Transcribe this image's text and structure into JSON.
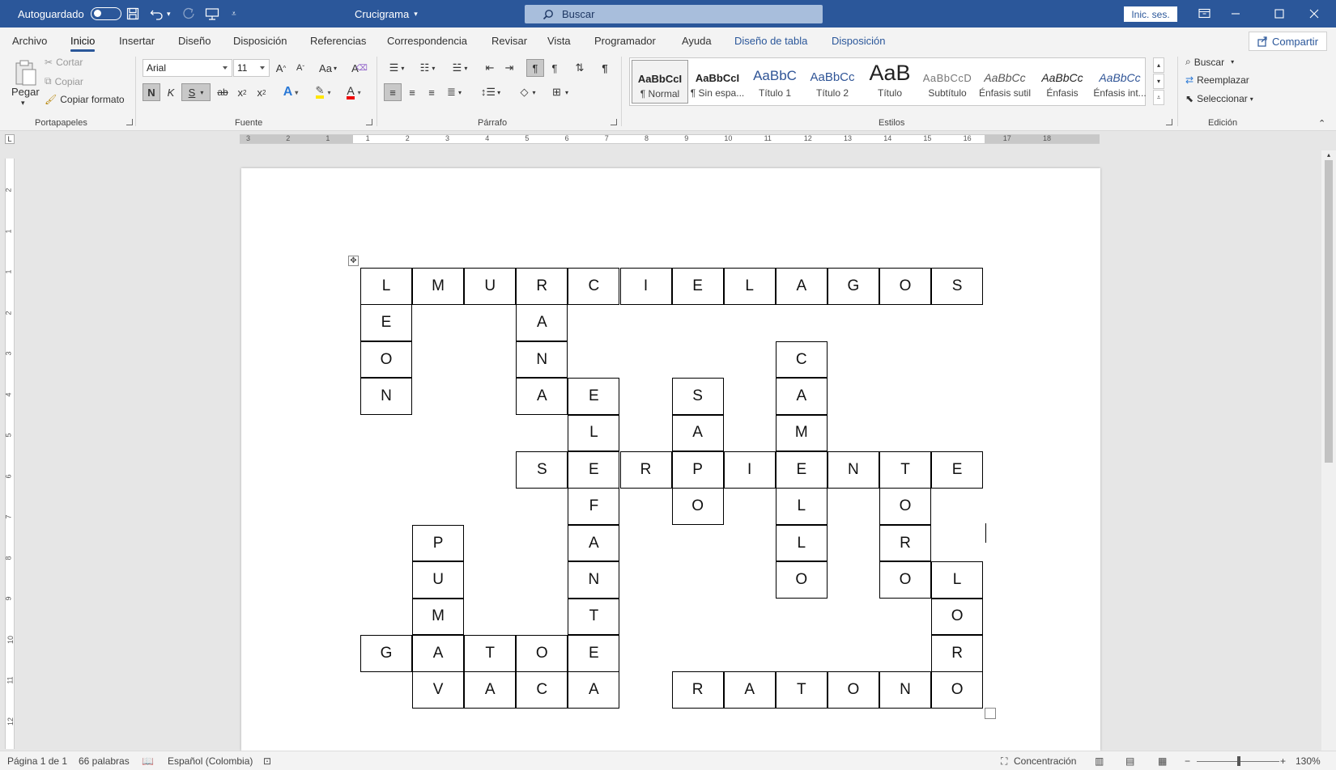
{
  "titlebar": {
    "autosave_label": "Autoguardado",
    "doc_title": "Crucigrama",
    "search_placeholder": "Buscar",
    "signin_label": "Inic. ses."
  },
  "menu": {
    "tabs": [
      "Archivo",
      "Inicio",
      "Insertar",
      "Diseño",
      "Disposición",
      "Referencias",
      "Correspondencia",
      "Revisar",
      "Vista",
      "Programador",
      "Ayuda"
    ],
    "contextual_tabs": [
      "Diseño de tabla",
      "Disposición"
    ],
    "active_tab": "Inicio",
    "share_label": "Compartir"
  },
  "ribbon": {
    "clipboard": {
      "paste_label": "Pegar",
      "cut_label": "Cortar",
      "copy_label": "Copiar",
      "format_painter_label": "Copiar formato",
      "group_label": "Portapapeles"
    },
    "font": {
      "font_name": "Arial",
      "font_size": "11",
      "bold": "N",
      "italic": "K",
      "underline": "S",
      "case_label": "Aa",
      "group_label": "Fuente"
    },
    "paragraph": {
      "group_label": "Párrafo"
    },
    "styles": {
      "items": [
        {
          "preview": "AaBbCcI",
          "name": "¶ Normal"
        },
        {
          "preview": "AaBbCcI",
          "name": "¶ Sin espa..."
        },
        {
          "preview": "AaBbC",
          "name": "Título 1"
        },
        {
          "preview": "AaBbCc",
          "name": "Título 2"
        },
        {
          "preview": "AaB",
          "name": "Título"
        },
        {
          "preview": "AaBbCcD",
          "name": "Subtítulo"
        },
        {
          "preview": "AaBbCc",
          "name": "Énfasis sutil"
        },
        {
          "preview": "AaBbCc",
          "name": "Énfasis"
        },
        {
          "preview": "AaBbCc",
          "name": "Énfasis int..."
        }
      ],
      "group_label": "Estilos"
    },
    "editing": {
      "find_label": "Buscar",
      "replace_label": "Reemplazar",
      "select_label": "Seleccionar",
      "group_label": "Edición"
    }
  },
  "ruler": {
    "h_numbers": [
      "3",
      "2",
      "1",
      "1",
      "2",
      "3",
      "4",
      "5",
      "6",
      "7",
      "8",
      "9",
      "10",
      "11",
      "12",
      "13",
      "14",
      "15",
      "16",
      "17",
      "18"
    ],
    "v_numbers": [
      "2",
      "1",
      "1",
      "2",
      "3",
      "4",
      "5",
      "6",
      "7",
      "8",
      "9",
      "10",
      "11",
      "12"
    ]
  },
  "crossword": {
    "cells": [
      {
        "r": 0,
        "c": 0,
        "l": "L"
      },
      {
        "r": 0,
        "c": 1,
        "l": "M"
      },
      {
        "r": 0,
        "c": 2,
        "l": "U"
      },
      {
        "r": 0,
        "c": 3,
        "l": "R"
      },
      {
        "r": 0,
        "c": 4,
        "l": "C"
      },
      {
        "r": 0,
        "c": 5,
        "l": "I"
      },
      {
        "r": 0,
        "c": 6,
        "l": "E"
      },
      {
        "r": 0,
        "c": 7,
        "l": "L"
      },
      {
        "r": 0,
        "c": 8,
        "l": "A"
      },
      {
        "r": 0,
        "c": 9,
        "l": "G"
      },
      {
        "r": 0,
        "c": 10,
        "l": "O"
      },
      {
        "r": 0,
        "c": 11,
        "l": "S"
      },
      {
        "r": 1,
        "c": 0,
        "l": "E"
      },
      {
        "r": 1,
        "c": 3,
        "l": "A"
      },
      {
        "r": 2,
        "c": 0,
        "l": "O"
      },
      {
        "r": 2,
        "c": 3,
        "l": "N"
      },
      {
        "r": 2,
        "c": 8,
        "l": "C"
      },
      {
        "r": 3,
        "c": 0,
        "l": "N"
      },
      {
        "r": 3,
        "c": 3,
        "l": "A"
      },
      {
        "r": 3,
        "c": 4,
        "l": "E"
      },
      {
        "r": 3,
        "c": 6,
        "l": "S"
      },
      {
        "r": 3,
        "c": 8,
        "l": "A"
      },
      {
        "r": 4,
        "c": 4,
        "l": "L"
      },
      {
        "r": 4,
        "c": 6,
        "l": "A"
      },
      {
        "r": 4,
        "c": 8,
        "l": "M"
      },
      {
        "r": 5,
        "c": 3,
        "l": "S"
      },
      {
        "r": 5,
        "c": 4,
        "l": "E"
      },
      {
        "r": 5,
        "c": 5,
        "l": "R"
      },
      {
        "r": 5,
        "c": 6,
        "l": "P"
      },
      {
        "r": 5,
        "c": 7,
        "l": "I"
      },
      {
        "r": 5,
        "c": 8,
        "l": "E"
      },
      {
        "r": 5,
        "c": 9,
        "l": "N"
      },
      {
        "r": 5,
        "c": 10,
        "l": "T"
      },
      {
        "r": 5,
        "c": 11,
        "l": "E"
      },
      {
        "r": 6,
        "c": 4,
        "l": "F"
      },
      {
        "r": 6,
        "c": 6,
        "l": "O"
      },
      {
        "r": 6,
        "c": 8,
        "l": "L"
      },
      {
        "r": 6,
        "c": 10,
        "l": "O"
      },
      {
        "r": 7,
        "c": 1,
        "l": "P"
      },
      {
        "r": 7,
        "c": 4,
        "l": "A"
      },
      {
        "r": 7,
        "c": 8,
        "l": "L"
      },
      {
        "r": 7,
        "c": 10,
        "l": "R"
      },
      {
        "r": 8,
        "c": 1,
        "l": "U"
      },
      {
        "r": 8,
        "c": 4,
        "l": "N"
      },
      {
        "r": 8,
        "c": 8,
        "l": "O"
      },
      {
        "r": 8,
        "c": 10,
        "l": "O"
      },
      {
        "r": 8,
        "c": 11,
        "l": "L"
      },
      {
        "r": 9,
        "c": 1,
        "l": "M"
      },
      {
        "r": 9,
        "c": 4,
        "l": "T"
      },
      {
        "r": 9,
        "c": 11,
        "l": "O"
      },
      {
        "r": 10,
        "c": 0,
        "l": "G"
      },
      {
        "r": 10,
        "c": 1,
        "l": "A"
      },
      {
        "r": 10,
        "c": 2,
        "l": "T"
      },
      {
        "r": 10,
        "c": 3,
        "l": "O"
      },
      {
        "r": 10,
        "c": 4,
        "l": "E"
      },
      {
        "r": 10,
        "c": 11,
        "l": "R"
      },
      {
        "r": 11,
        "c": 1,
        "l": "V"
      },
      {
        "r": 11,
        "c": 2,
        "l": "A"
      },
      {
        "r": 11,
        "c": 3,
        "l": "C"
      },
      {
        "r": 11,
        "c": 4,
        "l": "A"
      },
      {
        "r": 11,
        "c": 6,
        "l": "R"
      },
      {
        "r": 11,
        "c": 7,
        "l": "A"
      },
      {
        "r": 11,
        "c": 8,
        "l": "T"
      },
      {
        "r": 11,
        "c": 9,
        "l": "O"
      },
      {
        "r": 11,
        "c": 10,
        "l": "N"
      },
      {
        "r": 11,
        "c": 11,
        "l": "O"
      }
    ]
  },
  "status": {
    "page": "Página 1 de 1",
    "words": "66 palabras",
    "language": "Español (Colombia)",
    "focus": "Concentración",
    "zoom": "130%"
  },
  "colors": {
    "brand": "#2b579a"
  }
}
